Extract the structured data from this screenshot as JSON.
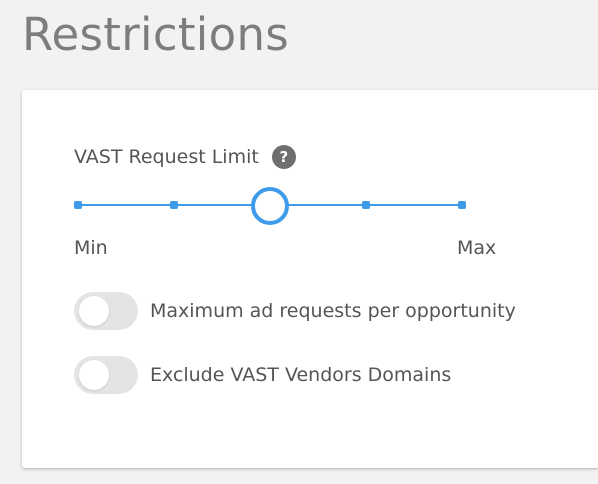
{
  "page": {
    "title": "Restrictions"
  },
  "vast_request_limit": {
    "label": "VAST Request Limit",
    "help_icon": "question-circle-icon",
    "help_glyph": "?",
    "slider": {
      "steps": 5,
      "selected_step_index": 2,
      "min_label": "Min",
      "max_label": "Max"
    }
  },
  "toggles": [
    {
      "label": "Maximum ad requests per opportunity",
      "checked": false
    },
    {
      "label": "Exclude VAST Vendors Domains",
      "checked": false
    }
  ],
  "colors": {
    "accent": "#3d9be9",
    "title_text": "#7d7d7d",
    "body_text": "#555555",
    "toggle_off": "#e4e4e4",
    "help_icon": "#6f6f6f",
    "page_background": "#f2f2f2",
    "card_background": "#ffffff"
  }
}
